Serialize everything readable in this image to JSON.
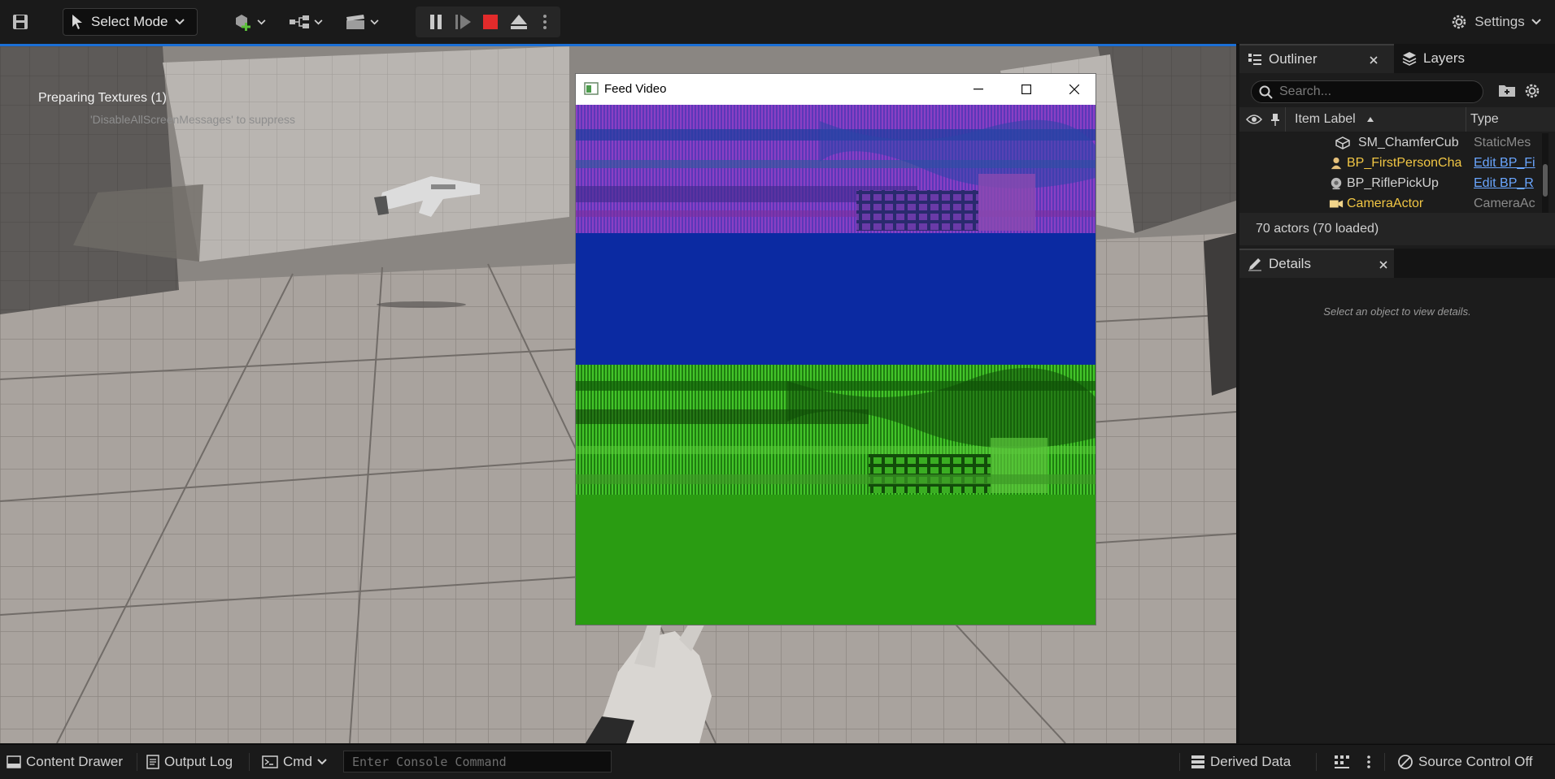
{
  "toolbar": {
    "mode_label": "Select Mode",
    "settings_label": "Settings"
  },
  "viewport": {
    "message_title": "Preparing Textures (1)",
    "message_hint": "'DisableAllScreenMessages' to suppress"
  },
  "feed_window": {
    "title": "Feed Video"
  },
  "outliner": {
    "tab_label": "Outliner",
    "layers_tab_label": "Layers",
    "search_placeholder": "Search...",
    "col_label": "Item Label",
    "col_type": "Type",
    "rows": [
      {
        "label": "SM_ChamferCub",
        "type": "StaticMes",
        "icon": "static-mesh-icon",
        "highlight": false,
        "type_link": false
      },
      {
        "label": "BP_FirstPersonCha",
        "type": "Edit BP_Fi",
        "icon": "character-icon",
        "highlight": true,
        "type_link": true
      },
      {
        "label": "BP_RiflePickUp",
        "type": "Edit BP_R",
        "icon": "pickup-icon",
        "highlight": false,
        "type_link": true
      },
      {
        "label": "CameraActor",
        "type": "CameraAc",
        "icon": "camera-icon",
        "highlight": true,
        "type_link": false
      }
    ],
    "actor_count": "70 actors (70 loaded)"
  },
  "details": {
    "tab_label": "Details",
    "empty_message": "Select an object to view details."
  },
  "bottombar": {
    "content_drawer": "Content Drawer",
    "output_log": "Output Log",
    "cmd": "Cmd",
    "console_placeholder": "Enter Console Command",
    "derived_data": "Derived Data",
    "source_control": "Source Control Off"
  },
  "colors": {
    "accent": "#1b6fd6",
    "highlight_text": "#f1c644",
    "link_text": "#6aa6ff",
    "stop_red": "#e22b2b",
    "feed_blue": "#0b2aa2",
    "feed_green": "#2a9c12"
  }
}
